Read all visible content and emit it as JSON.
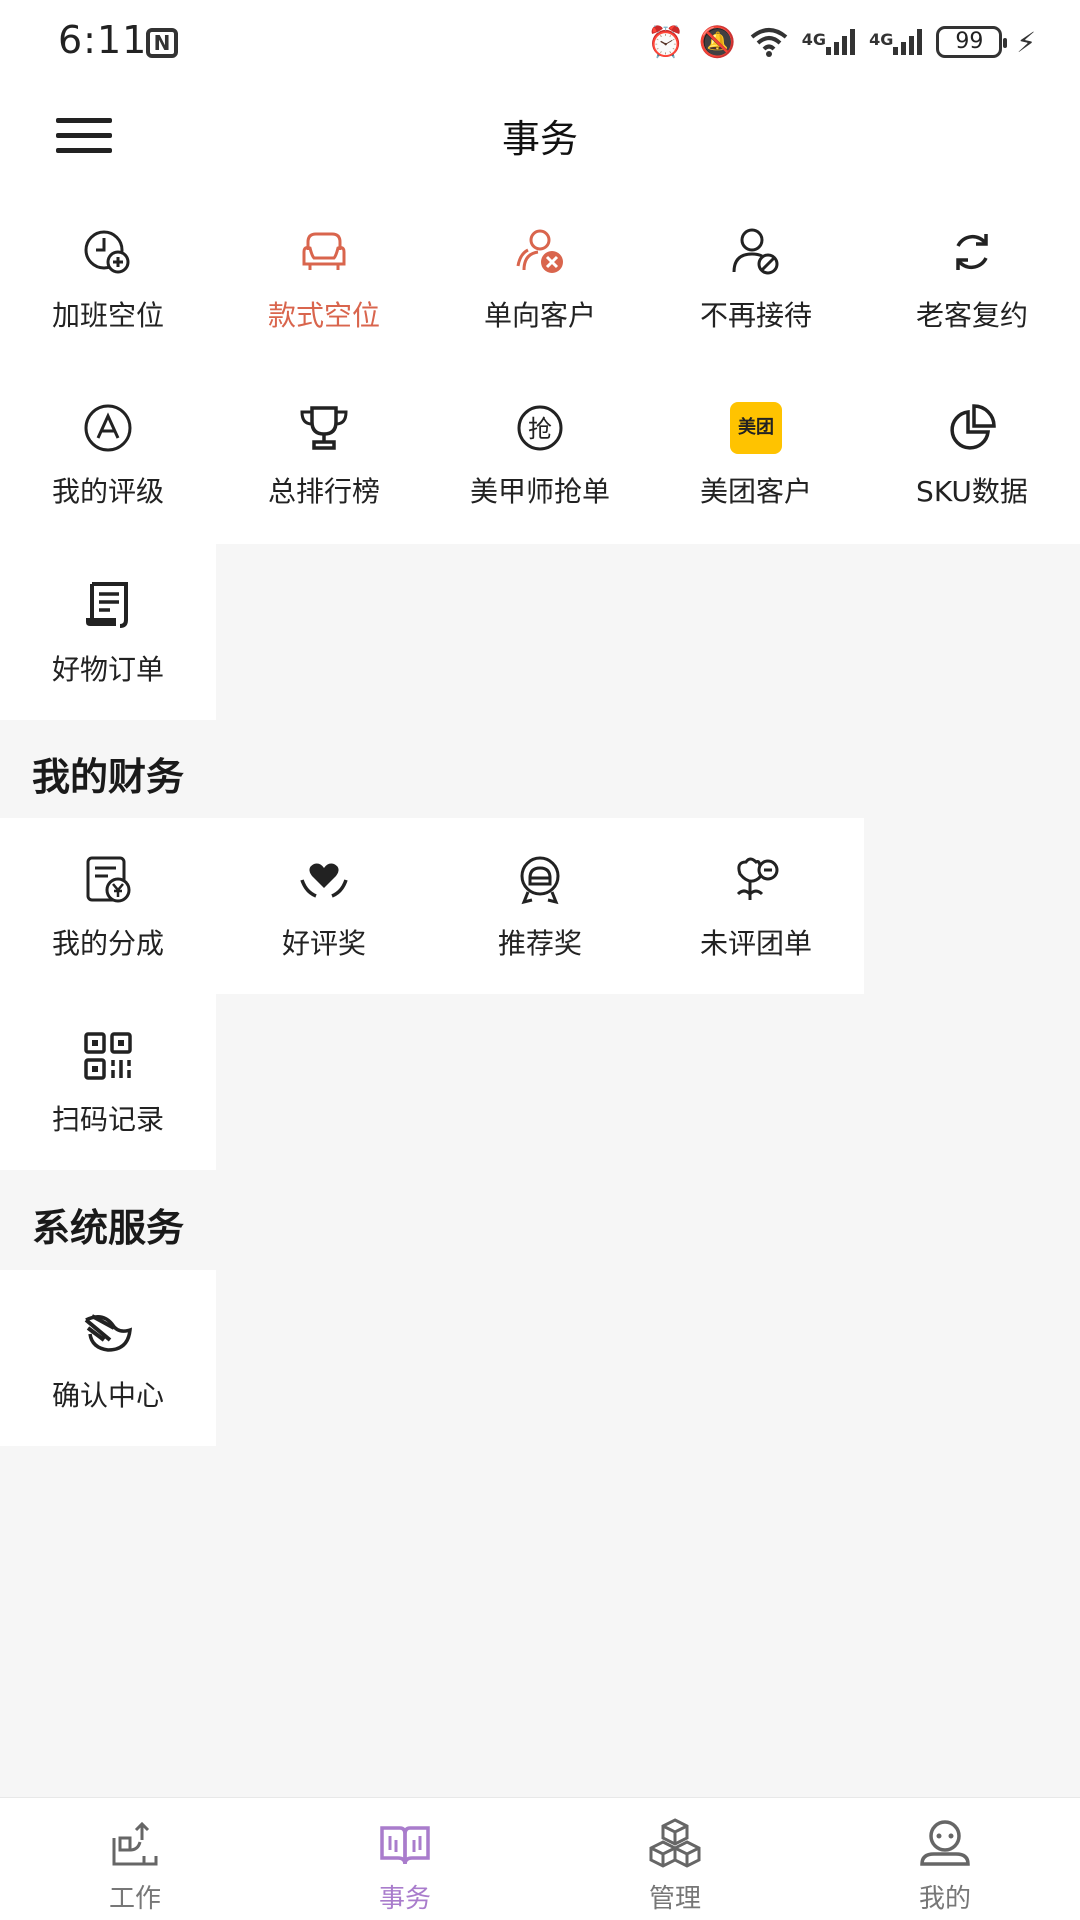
{
  "status_bar": {
    "time": "6:11",
    "nfc": "N",
    "network_1": "4G",
    "network_2": "4G",
    "battery": "99"
  },
  "header": {
    "title": "事务"
  },
  "grid_main": [
    {
      "label": "加班空位",
      "icon": "clock-plus-icon",
      "active": false
    },
    {
      "label": "款式空位",
      "icon": "sofa-icon",
      "active": true
    },
    {
      "label": "单向客户",
      "icon": "users-x-icon",
      "active": false
    },
    {
      "label": "不再接待",
      "icon": "user-block-icon",
      "active": false
    },
    {
      "label": "老客复约",
      "icon": "refresh-icon",
      "active": false
    },
    {
      "label": "我的评级",
      "icon": "grade-a-icon",
      "active": false
    },
    {
      "label": "总排行榜",
      "icon": "trophy-icon",
      "active": false
    },
    {
      "label": "美甲师抢单",
      "icon": "grab-order-icon",
      "icon_text": "抢",
      "active": false
    },
    {
      "label": "美团客户",
      "icon": "meituan-logo-icon",
      "icon_text": "美团",
      "active": false
    },
    {
      "label": "SKU数据",
      "icon": "pie-chart-icon",
      "active": false
    },
    {
      "label": "好物订单",
      "icon": "receipt-icon",
      "active": false
    }
  ],
  "section_finance": {
    "title": "我的财务"
  },
  "grid_finance": [
    {
      "label": "我的分成",
      "icon": "bill-yuan-icon"
    },
    {
      "label": "好评奖",
      "icon": "heart-hands-icon"
    },
    {
      "label": "推荐奖",
      "icon": "badge-icon"
    },
    {
      "label": "未评团单",
      "icon": "flower-minus-icon"
    },
    {
      "label": "扫码记录",
      "icon": "qr-code-icon"
    }
  ],
  "section_system": {
    "title": "系统服务"
  },
  "grid_system": [
    {
      "label": "确认中心",
      "icon": "leaf-check-icon"
    }
  ],
  "tabbar": [
    {
      "label": "工作",
      "icon": "work-icon",
      "active": false
    },
    {
      "label": "事务",
      "icon": "book-icon",
      "active": true
    },
    {
      "label": "管理",
      "icon": "cubes-icon",
      "active": false
    },
    {
      "label": "我的",
      "icon": "profile-icon",
      "active": false
    }
  ],
  "colors": {
    "accent": "#d9654d",
    "tab_active": "#a97ccc",
    "meituan": "#ffc300"
  }
}
